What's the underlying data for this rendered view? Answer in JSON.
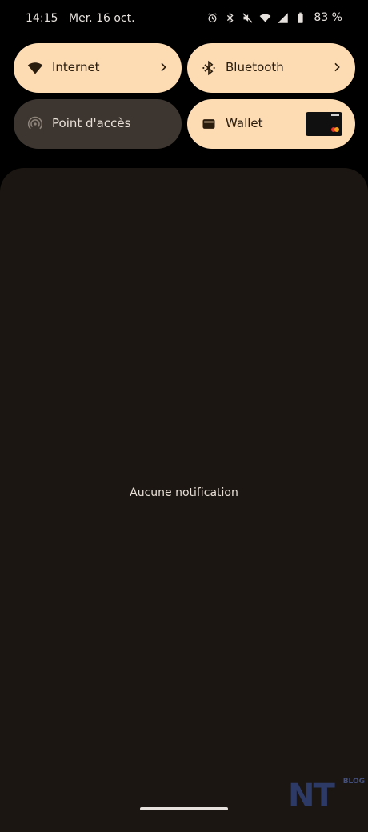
{
  "status_bar": {
    "time": "14:15",
    "date": "Mer. 16 oct.",
    "battery_percent": "83 %",
    "icons": [
      "alarm-icon",
      "bluetooth-icon",
      "mute-icon",
      "wifi-icon",
      "signal-icon",
      "battery-icon"
    ]
  },
  "quick_tiles": {
    "internet": {
      "label": "Internet",
      "icon": "wifi-icon",
      "active": true
    },
    "bluetooth": {
      "label": "Bluetooth",
      "icon": "bluetooth-icon",
      "active": true
    },
    "hotspot": {
      "label": "Point d'accès",
      "icon": "hotspot-icon",
      "active": false
    },
    "wallet": {
      "label": "Wallet",
      "icon": "wallet-icon",
      "active": true
    }
  },
  "notifications": {
    "empty_text": "Aucune notification"
  },
  "watermark": {
    "logo": "NT",
    "sub": "BLOG"
  },
  "colors": {
    "tile_on": "#fddcb4",
    "tile_off": "#3d3630",
    "panel_bg": "#1b1611",
    "background": "#000000"
  }
}
